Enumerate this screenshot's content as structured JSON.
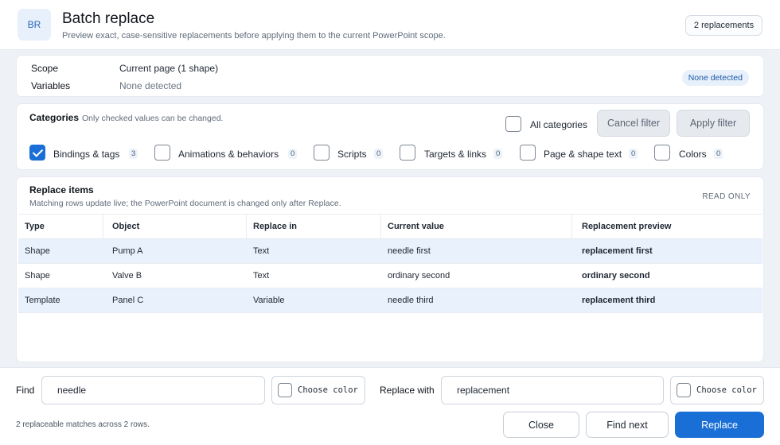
{
  "header": {
    "logo": "BR",
    "title": "Batch replace",
    "subtitle": "Preview exact, case-sensitive replacements before applying them to the current PowerPoint scope.",
    "count_badge": "2 replacements"
  },
  "scope": {
    "scope_label": "Scope",
    "scope_value": "Current page (1 shape)",
    "variables_label": "Variables",
    "variables_value": "None detected",
    "variables_pill": "None detected"
  },
  "categories": {
    "title": "Categories",
    "hint": "Only checked values can be changed.",
    "all_label": "All categories",
    "all_checked": false,
    "cancel_filter": "Cancel filter",
    "apply_filter": "Apply filter",
    "items": [
      {
        "label": "Bindings & tags",
        "count": "3",
        "checked": true
      },
      {
        "label": "Animations & behaviors",
        "count": "0",
        "checked": false
      },
      {
        "label": "Scripts",
        "count": "0",
        "checked": false
      },
      {
        "label": "Targets & links",
        "count": "0",
        "checked": false
      },
      {
        "label": "Page & shape text",
        "count": "0",
        "checked": false
      },
      {
        "label": "Colors",
        "count": "0",
        "checked": false
      }
    ]
  },
  "items": {
    "title": "Replace items",
    "subtitle": "Matching rows update live; the PowerPoint document is changed only after Replace.",
    "readonly": "READ ONLY",
    "columns": [
      "Type",
      "Object",
      "Replace in",
      "Current value",
      "Replacement preview"
    ],
    "rows": [
      {
        "type": "Shape",
        "object": "Pump A",
        "replace_in": "Text",
        "current": "needle first",
        "preview": "replacement first",
        "selected": true
      },
      {
        "type": "Shape",
        "object": "Valve B",
        "replace_in": "Text",
        "current": "ordinary second",
        "preview": "ordinary second",
        "selected": false
      },
      {
        "type": "Template",
        "object": "Panel C",
        "replace_in": "Variable",
        "current": "needle third",
        "preview": "replacement third",
        "selected": true
      }
    ]
  },
  "footer": {
    "find_label": "Find",
    "find_value": "needle",
    "replace_label": "Replace with",
    "replace_value": "replacement",
    "choose_color": "Choose color",
    "status": "2 replaceable matches across 2 rows.",
    "close": "Close",
    "find_next": "Find next",
    "replace": "Replace"
  },
  "colors": {
    "accent": "#1a6fd6",
    "selected_row": "#e8f1fc",
    "background": "#eef2f7"
  }
}
